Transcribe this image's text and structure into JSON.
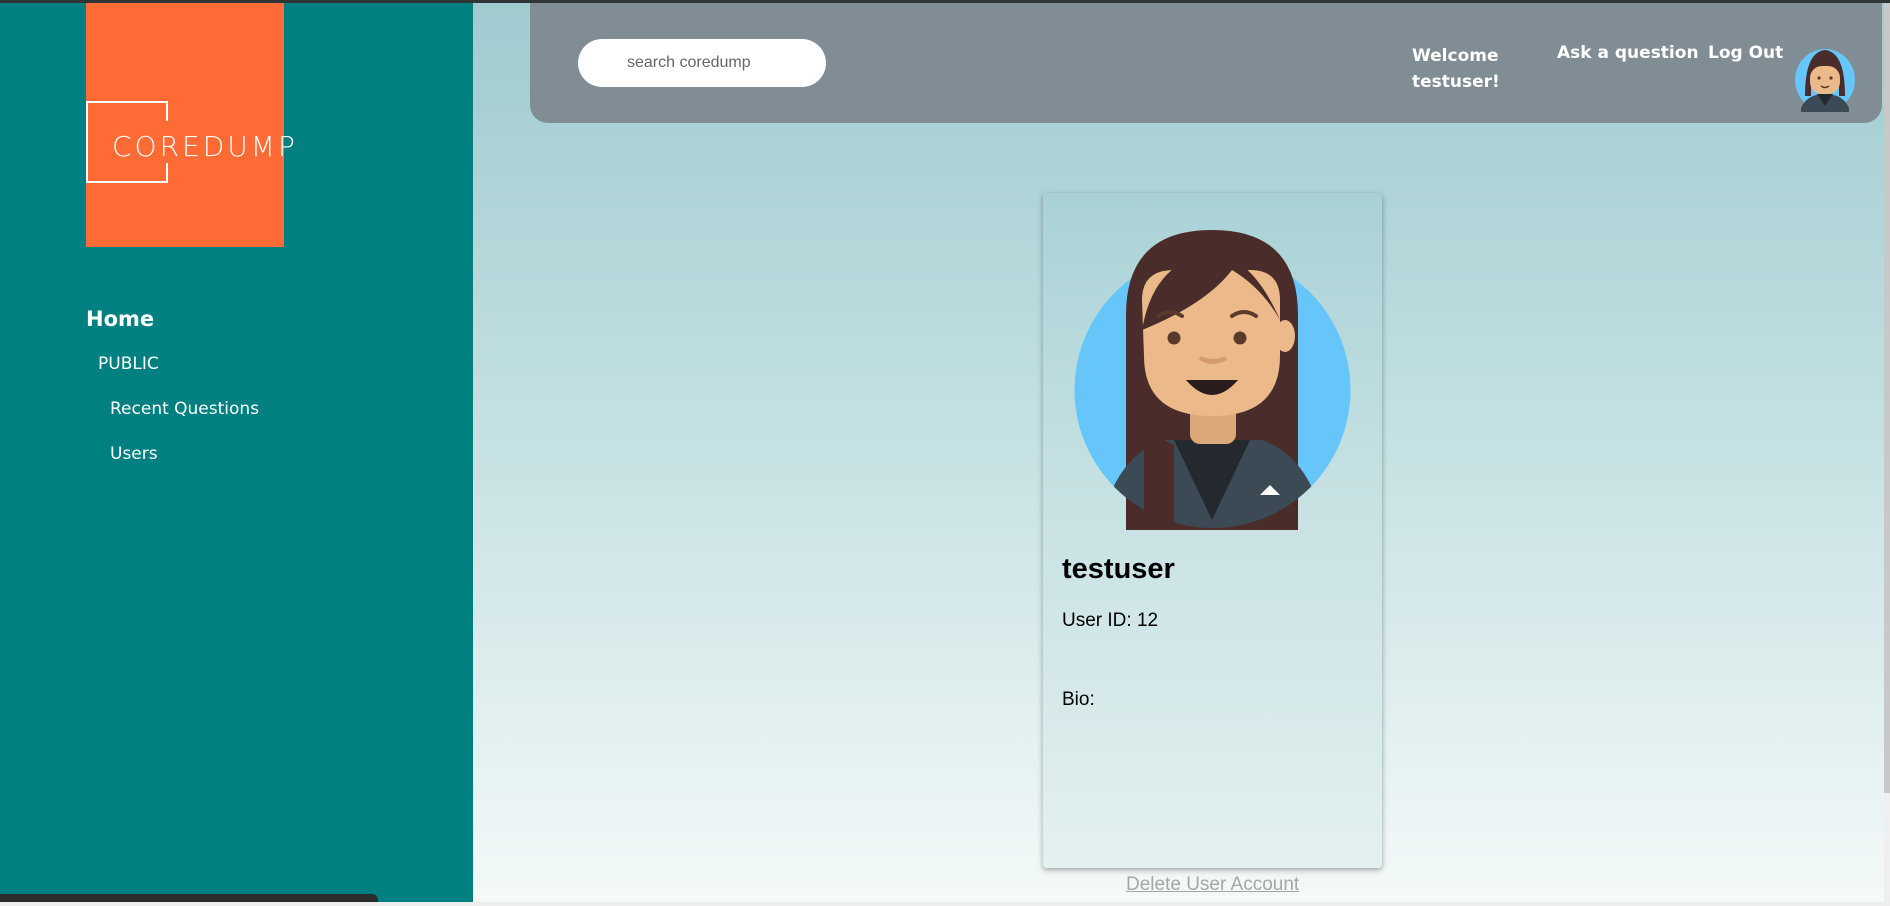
{
  "brand": {
    "logo_text": "COREDUMP",
    "accent_color": "#ff6b35",
    "sidebar_color": "#008080"
  },
  "sidebar": {
    "home_label": "Home",
    "section_label": "PUBLIC",
    "items": [
      {
        "label": "Recent Questions"
      },
      {
        "label": "Users"
      }
    ]
  },
  "header": {
    "search": {
      "placeholder": "search coredump",
      "value": ""
    },
    "welcome": "Welcome testuser!",
    "ask_label": "Ask a question",
    "logout_label": "Log Out",
    "avatar_icon": "user-avatar-icon"
  },
  "profile": {
    "username": "testuser",
    "user_id_text": "User ID: 12",
    "bio_text": "Bio:",
    "avatar_icon": "user-avatar-icon"
  },
  "actions": {
    "delete_label": "Delete User Account"
  }
}
